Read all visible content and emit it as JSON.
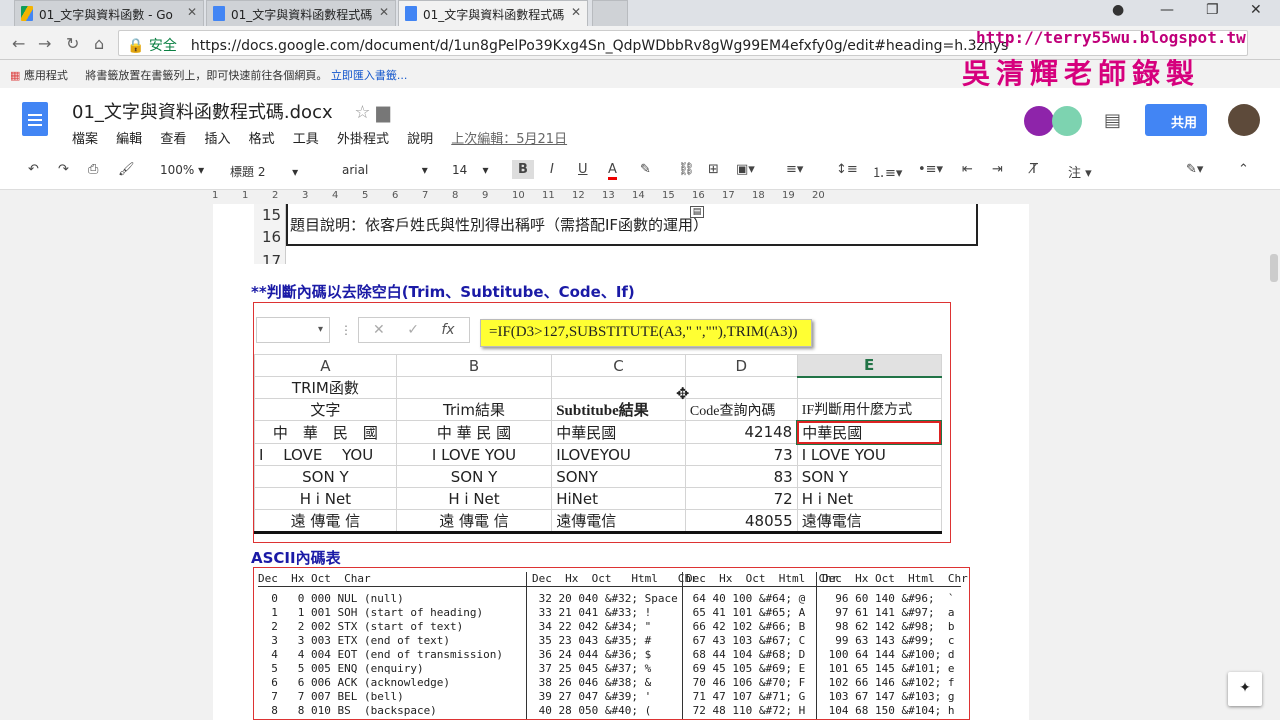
{
  "tabs": [
    {
      "label": "01_文字與資料函數 - Go",
      "icon": "drive-icon"
    },
    {
      "label": "01_文字與資料函數程式碼",
      "icon": "docs-icon"
    },
    {
      "label": "01_文字與資料函數程式碼",
      "icon": "docs-icon"
    }
  ],
  "address": {
    "secure": "安全",
    "url": "https://docs.google.com/document/d/1un8gPelPo39Kxg4Sn_QdpWDbbRv8gWg99EM4efxfy0g/edit#heading=h.3znys"
  },
  "bookmarks": {
    "apps": "應用程式",
    "hint": "將書籤放置在書籤列上，即可快速前往各個網頁。",
    "link": "立即匯入書籤..."
  },
  "watermark": {
    "url": "http://terry55wu.blogspot.tw",
    "name": "吳清輝老師錄製"
  },
  "doc": {
    "title": "01_文字與資料函數程式碼.docx",
    "menus": [
      "檔案",
      "編輯",
      "查看",
      "插入",
      "格式",
      "工具",
      "外掛程式",
      "說明"
    ],
    "last_edit": "上次編輯：5月21日",
    "share": "共用"
  },
  "toolbar": {
    "zoom": "100%",
    "style": "標題 2",
    "font": "arial",
    "size": "14",
    "note": "注"
  },
  "ruler": [
    "1",
    "1",
    "2",
    "3",
    "4",
    "5",
    "6",
    "7",
    "8",
    "9",
    "10",
    "11",
    "12",
    "13",
    "14",
    "15",
    "16",
    "17",
    "18",
    "19",
    "20"
  ],
  "rows_top": {
    "r15": "15",
    "r16": "16",
    "r17": "17",
    "desc": "題目說明：依客戶姓氏與性別得出稱呼（需搭配IF函數的運用）"
  },
  "section1": "**判斷內碼以去除空白(Trim、Subtitube、Code、If)",
  "formula": "=IF(D3>127,SUBSTITUTE(A3,\" \",\"\"),TRIM(A3))",
  "cols": [
    "A",
    "B",
    "C",
    "D",
    "E"
  ],
  "grid": [
    [
      "TRIM函數",
      "",
      "",
      "",
      ""
    ],
    [
      "文字",
      "Trim結果",
      "Subtitube結果",
      "Code查詢內碼",
      "IF判斷用什麼方式"
    ],
    [
      "中　華　民　國",
      "中 華 民 國",
      "中華民國",
      "42148",
      "中華民國"
    ],
    [
      "I　 LOVE　 YOU",
      "I LOVE YOU",
      "ILOVEYOU",
      "73",
      "I LOVE YOU"
    ],
    [
      "SON Y",
      "SON Y",
      "SONY",
      "83",
      "SON Y"
    ],
    [
      "H i  Net",
      "H i Net",
      "HiNet",
      "72",
      "H i Net"
    ],
    [
      "遠  傳電  信",
      "遠 傳電 信",
      "遠傳電信",
      "48055",
      "遠傳電信"
    ]
  ],
  "section2": "ASCII內碼表",
  "ascii_head": [
    "Dec  Hx Oct  Char",
    "Dec  Hx  Oct   Html   Chr",
    "Dec  Hx  Oct  Html  Chr",
    "Dec  Hx Oct  Html  Chr"
  ],
  "ascii_c1": [
    "  0   0 000 NUL (null)",
    "  1   1 001 SOH (start of heading)",
    "  2   2 002 STX (start of text)",
    "  3   3 003 ETX (end of text)",
    "  4   4 004 EOT (end of transmission)",
    "  5   5 005 ENQ (enquiry)",
    "  6   6 006 ACK (acknowledge)",
    "  7   7 007 BEL (bell)",
    "  8   8 010 BS  (backspace)"
  ],
  "ascii_c2": [
    " 32 20 040 &#32; Space",
    " 33 21 041 &#33; !",
    " 34 22 042 &#34; \"",
    " 35 23 043 &#35; #",
    " 36 24 044 &#36; $",
    " 37 25 045 &#37; %",
    " 38 26 046 &#38; &",
    " 39 27 047 &#39; '",
    " 40 28 050 &#40; ("
  ],
  "ascii_c3": [
    " 64 40 100 &#64; @",
    " 65 41 101 &#65; A",
    " 66 42 102 &#66; B",
    " 67 43 103 &#67; C",
    " 68 44 104 &#68; D",
    " 69 45 105 &#69; E",
    " 70 46 106 &#70; F",
    " 71 47 107 &#71; G",
    " 72 48 110 &#72; H"
  ],
  "ascii_c4": [
    "  96 60 140 &#96;  `",
    "  97 61 141 &#97;  a",
    "  98 62 142 &#98;  b",
    "  99 63 143 &#99;  c",
    " 100 64 144 &#100; d",
    " 101 65 145 &#101; e",
    " 102 66 146 &#102; f",
    " 103 67 147 &#103; g",
    " 104 68 150 &#104; h"
  ]
}
